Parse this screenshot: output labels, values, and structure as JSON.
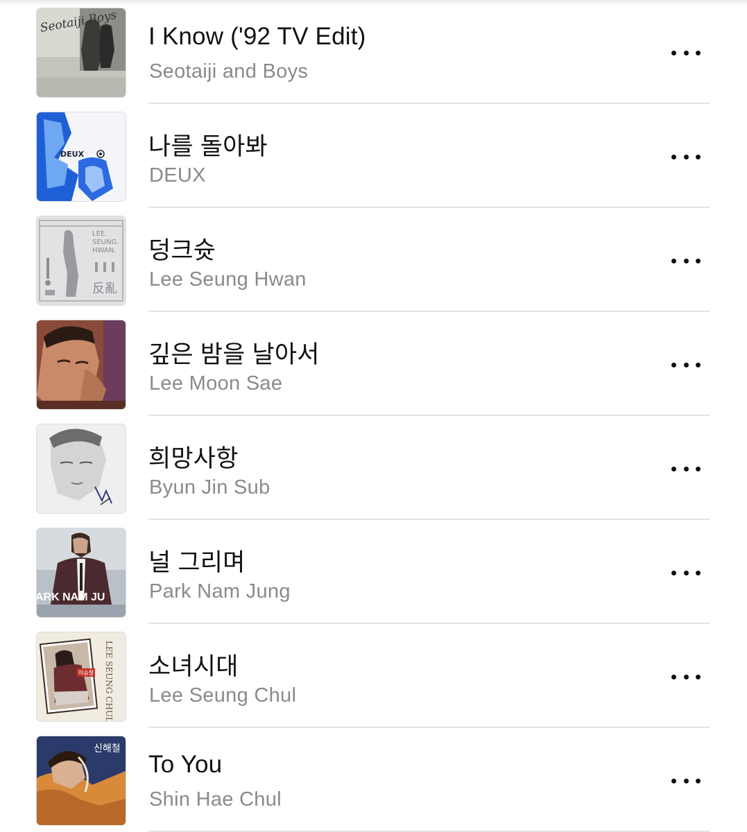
{
  "tracks": [
    {
      "title": "I Know ('92 TV Edit)",
      "artist": "Seotaiji and Boys",
      "art": "seotaiji-album-art"
    },
    {
      "title": "나를 돌아봐",
      "artist": "DEUX",
      "art": "deux-album-art"
    },
    {
      "title": "덩크슛",
      "artist": "Lee Seung Hwan",
      "art": "lee-seung-hwan-album-art"
    },
    {
      "title": "깊은 밤을 날아서",
      "artist": "Lee Moon Sae",
      "art": "lee-moon-sae-album-art"
    },
    {
      "title": "희망사항",
      "artist": "Byun Jin Sub",
      "art": "byun-jin-sub-album-art"
    },
    {
      "title": "널 그리며",
      "artist": "Park Nam Jung",
      "art": "park-nam-jung-album-art"
    },
    {
      "title": "소녀시대",
      "artist": "Lee Seung Chul",
      "art": "lee-seung-chul-album-art"
    },
    {
      "title": "To You",
      "artist": "Shin Hae Chul",
      "art": "shin-hae-chul-album-art"
    }
  ],
  "art_text": {
    "seotaiji": "Seotaiji Boys",
    "deux": "DEUX",
    "lee_seung_hwan": [
      "LEE.",
      "SEUNG.",
      "HWAN."
    ],
    "lee_seung_hwan_hanja": "反亂",
    "park_nam_jung": "ARK NAM JU",
    "lee_seung_chul": "LEE SEUNG CHUL",
    "lee_seung_chul_name": "이승철",
    "shin_hae_chul": "신해철"
  },
  "more_icon": "ellipsis-icon"
}
